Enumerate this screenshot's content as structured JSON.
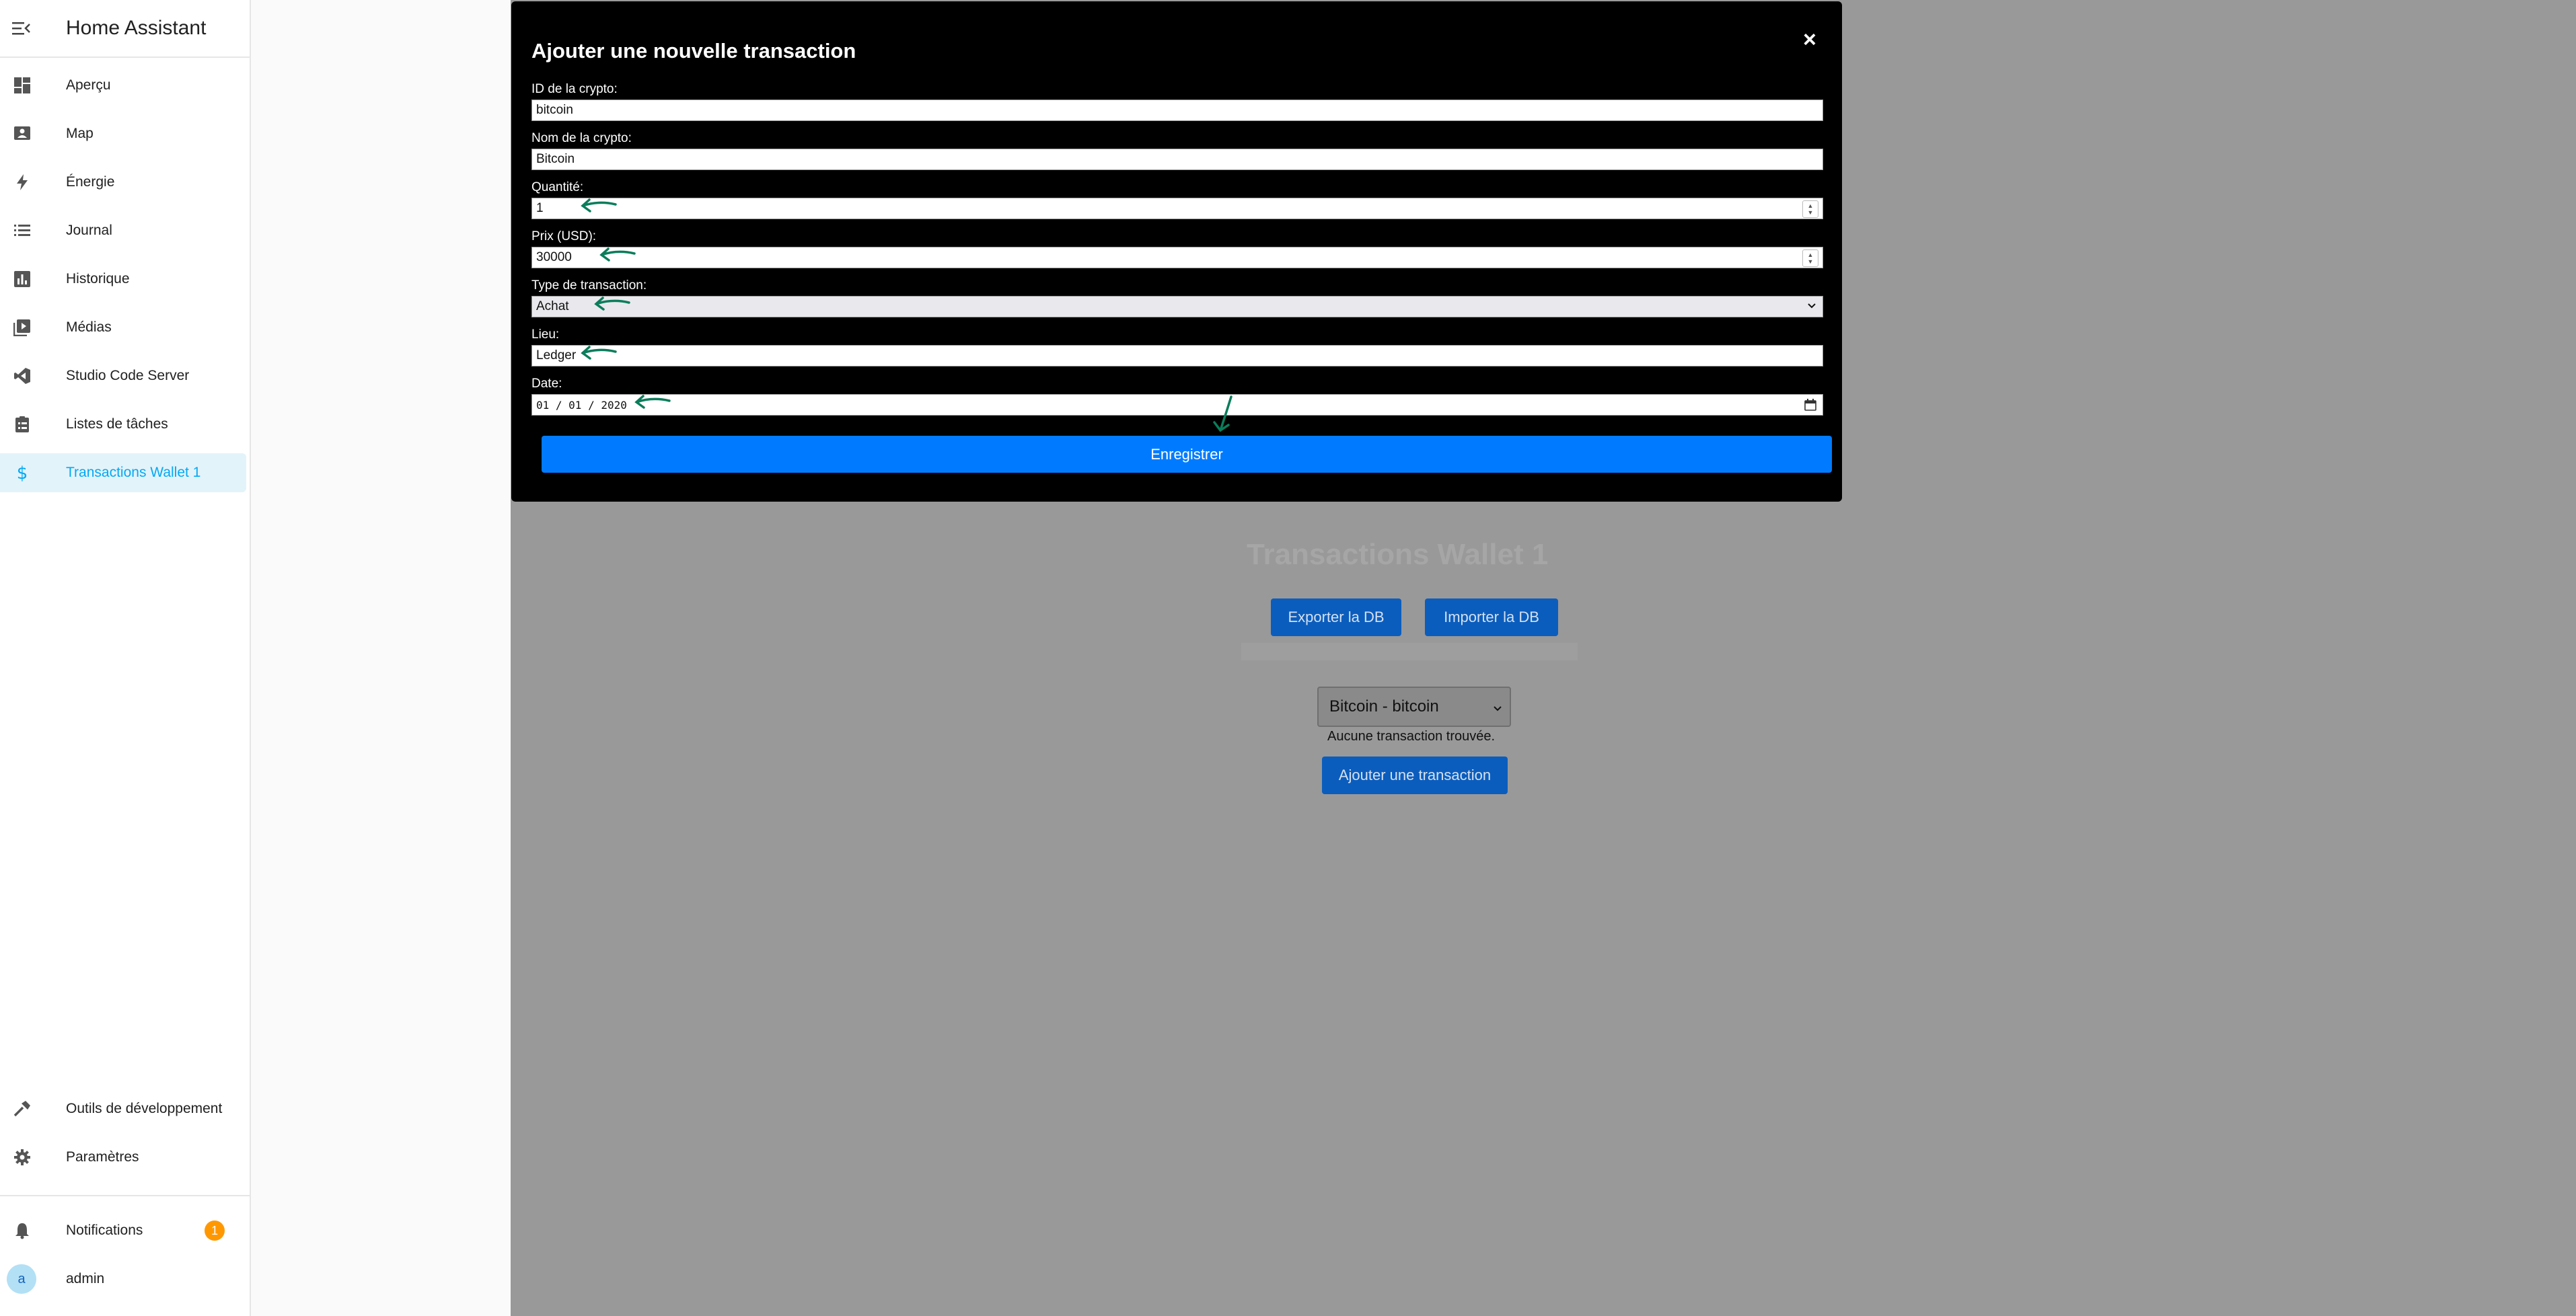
{
  "sidebar": {
    "title": "Home Assistant",
    "items": [
      {
        "label": "Aperçu",
        "icon": "dashboard-icon"
      },
      {
        "label": "Map",
        "icon": "map-icon"
      },
      {
        "label": "Énergie",
        "icon": "lightning-icon"
      },
      {
        "label": "Journal",
        "icon": "list-icon"
      },
      {
        "label": "Historique",
        "icon": "chart-icon"
      },
      {
        "label": "Médias",
        "icon": "media-icon"
      },
      {
        "label": "Studio Code Server",
        "icon": "vscode-icon"
      },
      {
        "label": "Listes de tâches",
        "icon": "clipboard-icon"
      },
      {
        "label": "Transactions Wallet 1",
        "icon": "dollar-icon",
        "active": true
      }
    ],
    "bottom_items": [
      {
        "label": "Outils de développement",
        "icon": "hammer-icon"
      },
      {
        "label": "Paramètres",
        "icon": "gear-icon"
      }
    ],
    "notifications": {
      "label": "Notifications",
      "count": "1"
    },
    "user": {
      "label": "admin",
      "initial": "a"
    }
  },
  "background": {
    "heading": "Transactions Wallet 1",
    "export_button": "Exporter la DB",
    "import_button": "Importer la DB",
    "crypto_select": "Bitcoin - bitcoin",
    "empty_message": "Aucune transaction trouvée.",
    "add_button": "Ajouter une transaction"
  },
  "modal": {
    "title": "Ajouter une nouvelle transaction",
    "close": "×",
    "fields": {
      "crypto_id": {
        "label": "ID de la crypto:",
        "value": "bitcoin"
      },
      "crypto_name": {
        "label": "Nom de la crypto:",
        "value": "Bitcoin"
      },
      "quantity": {
        "label": "Quantité:",
        "value": "1"
      },
      "price": {
        "label": "Prix (USD):",
        "value": "30000"
      },
      "type": {
        "label": "Type de transaction:",
        "value": "Achat"
      },
      "location": {
        "label": "Lieu:",
        "value": "Ledger"
      },
      "date": {
        "label": "Date:",
        "value": "01 / 01 / 2020"
      }
    },
    "save_button": "Enregistrer"
  },
  "colors": {
    "accent": "#03a9f4",
    "primary_button": "#007bff",
    "annotation_arrow": "#0a7d5a",
    "badge": "#ff9800"
  }
}
